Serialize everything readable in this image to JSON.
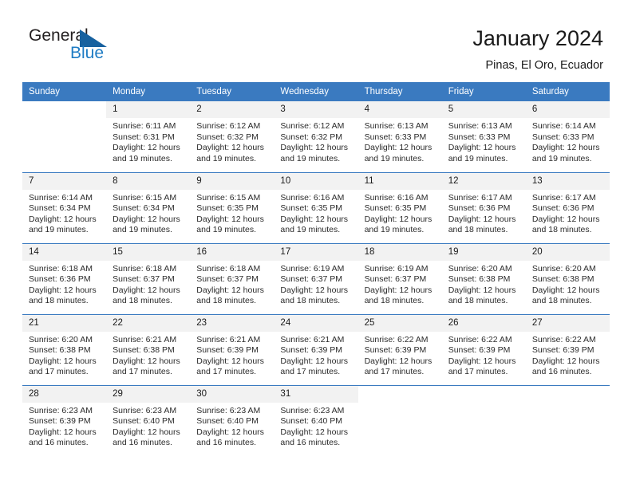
{
  "logo": {
    "word_one": "General",
    "word_two": "Blue",
    "triangle_color": "#17619f",
    "blue_color": "#1f7cc4"
  },
  "header": {
    "title": "January 2024",
    "subtitle": "Pinas, El Oro, Ecuador",
    "accent_color": "#3a7ac0"
  },
  "weekdays": [
    "Sunday",
    "Monday",
    "Tuesday",
    "Wednesday",
    "Thursday",
    "Friday",
    "Saturday"
  ],
  "weeks": [
    [
      {
        "day": "",
        "blank": true,
        "lines": []
      },
      {
        "day": "1",
        "lines": [
          "Sunrise: 6:11 AM",
          "Sunset: 6:31 PM",
          "Daylight: 12 hours and 19 minutes."
        ]
      },
      {
        "day": "2",
        "lines": [
          "Sunrise: 6:12 AM",
          "Sunset: 6:32 PM",
          "Daylight: 12 hours and 19 minutes."
        ]
      },
      {
        "day": "3",
        "lines": [
          "Sunrise: 6:12 AM",
          "Sunset: 6:32 PM",
          "Daylight: 12 hours and 19 minutes."
        ]
      },
      {
        "day": "4",
        "lines": [
          "Sunrise: 6:13 AM",
          "Sunset: 6:33 PM",
          "Daylight: 12 hours and 19 minutes."
        ]
      },
      {
        "day": "5",
        "lines": [
          "Sunrise: 6:13 AM",
          "Sunset: 6:33 PM",
          "Daylight: 12 hours and 19 minutes."
        ]
      },
      {
        "day": "6",
        "lines": [
          "Sunrise: 6:14 AM",
          "Sunset: 6:33 PM",
          "Daylight: 12 hours and 19 minutes."
        ]
      }
    ],
    [
      {
        "day": "7",
        "lines": [
          "Sunrise: 6:14 AM",
          "Sunset: 6:34 PM",
          "Daylight: 12 hours and 19 minutes."
        ]
      },
      {
        "day": "8",
        "lines": [
          "Sunrise: 6:15 AM",
          "Sunset: 6:34 PM",
          "Daylight: 12 hours and 19 minutes."
        ]
      },
      {
        "day": "9",
        "lines": [
          "Sunrise: 6:15 AM",
          "Sunset: 6:35 PM",
          "Daylight: 12 hours and 19 minutes."
        ]
      },
      {
        "day": "10",
        "lines": [
          "Sunrise: 6:16 AM",
          "Sunset: 6:35 PM",
          "Daylight: 12 hours and 19 minutes."
        ]
      },
      {
        "day": "11",
        "lines": [
          "Sunrise: 6:16 AM",
          "Sunset: 6:35 PM",
          "Daylight: 12 hours and 19 minutes."
        ]
      },
      {
        "day": "12",
        "lines": [
          "Sunrise: 6:17 AM",
          "Sunset: 6:36 PM",
          "Daylight: 12 hours and 18 minutes."
        ]
      },
      {
        "day": "13",
        "lines": [
          "Sunrise: 6:17 AM",
          "Sunset: 6:36 PM",
          "Daylight: 12 hours and 18 minutes."
        ]
      }
    ],
    [
      {
        "day": "14",
        "lines": [
          "Sunrise: 6:18 AM",
          "Sunset: 6:36 PM",
          "Daylight: 12 hours and 18 minutes."
        ]
      },
      {
        "day": "15",
        "lines": [
          "Sunrise: 6:18 AM",
          "Sunset: 6:37 PM",
          "Daylight: 12 hours and 18 minutes."
        ]
      },
      {
        "day": "16",
        "lines": [
          "Sunrise: 6:18 AM",
          "Sunset: 6:37 PM",
          "Daylight: 12 hours and 18 minutes."
        ]
      },
      {
        "day": "17",
        "lines": [
          "Sunrise: 6:19 AM",
          "Sunset: 6:37 PM",
          "Daylight: 12 hours and 18 minutes."
        ]
      },
      {
        "day": "18",
        "lines": [
          "Sunrise: 6:19 AM",
          "Sunset: 6:37 PM",
          "Daylight: 12 hours and 18 minutes."
        ]
      },
      {
        "day": "19",
        "lines": [
          "Sunrise: 6:20 AM",
          "Sunset: 6:38 PM",
          "Daylight: 12 hours and 18 minutes."
        ]
      },
      {
        "day": "20",
        "lines": [
          "Sunrise: 6:20 AM",
          "Sunset: 6:38 PM",
          "Daylight: 12 hours and 18 minutes."
        ]
      }
    ],
    [
      {
        "day": "21",
        "lines": [
          "Sunrise: 6:20 AM",
          "Sunset: 6:38 PM",
          "Daylight: 12 hours and 17 minutes."
        ]
      },
      {
        "day": "22",
        "lines": [
          "Sunrise: 6:21 AM",
          "Sunset: 6:38 PM",
          "Daylight: 12 hours and 17 minutes."
        ]
      },
      {
        "day": "23",
        "lines": [
          "Sunrise: 6:21 AM",
          "Sunset: 6:39 PM",
          "Daylight: 12 hours and 17 minutes."
        ]
      },
      {
        "day": "24",
        "lines": [
          "Sunrise: 6:21 AM",
          "Sunset: 6:39 PM",
          "Daylight: 12 hours and 17 minutes."
        ]
      },
      {
        "day": "25",
        "lines": [
          "Sunrise: 6:22 AM",
          "Sunset: 6:39 PM",
          "Daylight: 12 hours and 17 minutes."
        ]
      },
      {
        "day": "26",
        "lines": [
          "Sunrise: 6:22 AM",
          "Sunset: 6:39 PM",
          "Daylight: 12 hours and 17 minutes."
        ]
      },
      {
        "day": "27",
        "lines": [
          "Sunrise: 6:22 AM",
          "Sunset: 6:39 PM",
          "Daylight: 12 hours and 16 minutes."
        ]
      }
    ],
    [
      {
        "day": "28",
        "lines": [
          "Sunrise: 6:23 AM",
          "Sunset: 6:39 PM",
          "Daylight: 12 hours and 16 minutes."
        ]
      },
      {
        "day": "29",
        "lines": [
          "Sunrise: 6:23 AM",
          "Sunset: 6:40 PM",
          "Daylight: 12 hours and 16 minutes."
        ]
      },
      {
        "day": "30",
        "lines": [
          "Sunrise: 6:23 AM",
          "Sunset: 6:40 PM",
          "Daylight: 12 hours and 16 minutes."
        ]
      },
      {
        "day": "31",
        "lines": [
          "Sunrise: 6:23 AM",
          "Sunset: 6:40 PM",
          "Daylight: 12 hours and 16 minutes."
        ]
      },
      {
        "day": "",
        "blank": true,
        "lines": []
      },
      {
        "day": "",
        "blank": true,
        "lines": []
      },
      {
        "day": "",
        "blank": true,
        "lines": []
      }
    ]
  ]
}
